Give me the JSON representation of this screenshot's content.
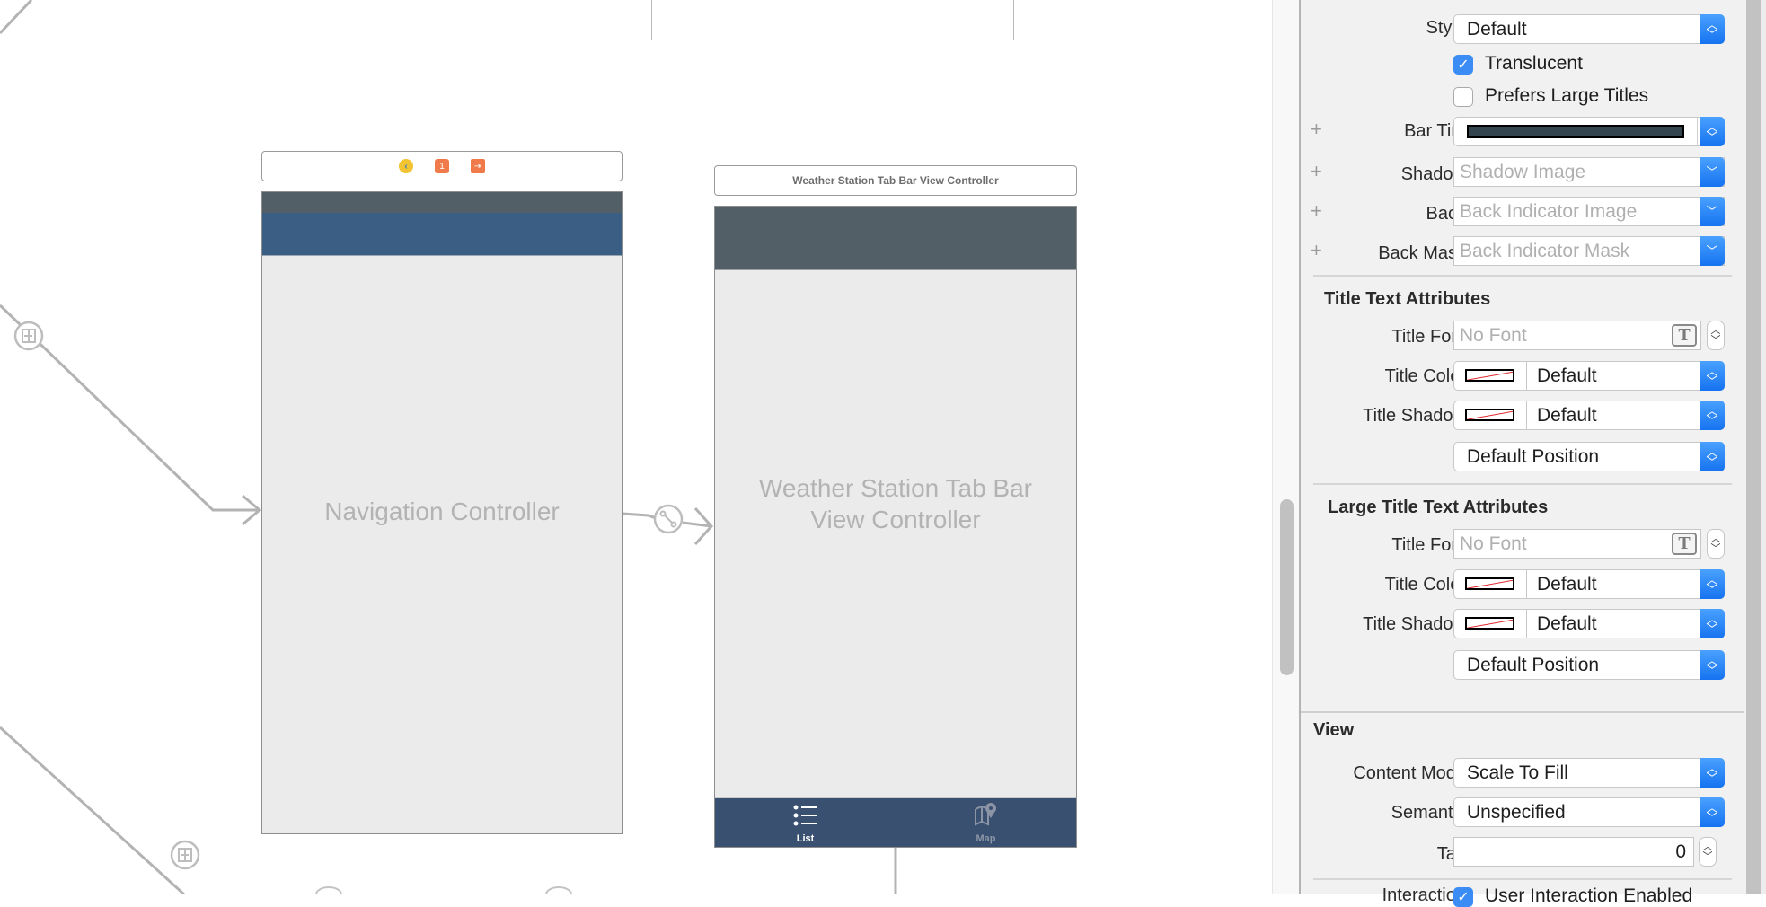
{
  "canvas": {
    "nav_scene": {
      "dock_icons": [
        "back-circle-icon",
        "first-responder-cube-icon",
        "exit-icon"
      ],
      "center_title": "Navigation Controller",
      "colors": {
        "status_bar": "#525f66",
        "nav_bar": "#3a5e84",
        "body": "#ebebeb"
      }
    },
    "tab_scene": {
      "dock_title": "Weather Station Tab Bar View Controller",
      "center_title_line1": "Weather Station Tab Bar",
      "center_title_line2": "View Controller",
      "tabs": [
        {
          "label": "List",
          "icon": "list-icon",
          "selected": true
        },
        {
          "label": "Map",
          "icon": "map-pin-icon",
          "selected": false
        }
      ],
      "colors": {
        "top_bar": "#525f66",
        "tab_bar": "#3a5071",
        "selected_tab": "#ffffff",
        "unselected_tab": "#8c95a5"
      }
    },
    "segue_icons": [
      "embed-segue-icon",
      "relationship-segue-icon",
      "embed-segue-icon"
    ]
  },
  "inspector": {
    "navigation_bar": {
      "style": {
        "label": "Style",
        "value": "Default"
      },
      "translucent": {
        "label": "Translucent",
        "checked": true
      },
      "prefers_large_titles": {
        "label": "Prefers Large Titles",
        "checked": false
      },
      "bar_tint": {
        "label": "Bar Tint",
        "color": "#34454f"
      },
      "shadow": {
        "label": "Shadow",
        "placeholder": "Shadow Image"
      },
      "back": {
        "label": "Back",
        "placeholder": "Back Indicator Image"
      },
      "back_mask": {
        "label": "Back Mask",
        "placeholder": "Back Indicator Mask"
      }
    },
    "title_text_attributes": {
      "heading": "Title Text Attributes",
      "title_font": {
        "label": "Title Font",
        "placeholder": "No Font"
      },
      "title_color": {
        "label": "Title Color",
        "value": "Default"
      },
      "title_shadow": {
        "label": "Title Shadow",
        "value": "Default"
      },
      "position": {
        "value": "Default Position"
      }
    },
    "large_title_text_attributes": {
      "heading": "Large Title Text Attributes",
      "title_font": {
        "label": "Title Font",
        "placeholder": "No Font"
      },
      "title_color": {
        "label": "Title Color",
        "value": "Default"
      },
      "title_shadow": {
        "label": "Title Shadow",
        "value": "Default"
      },
      "position": {
        "value": "Default Position"
      }
    },
    "view": {
      "heading": "View",
      "content_mode": {
        "label": "Content Mode",
        "value": "Scale To Fill"
      },
      "semantic": {
        "label": "Semantic",
        "value": "Unspecified"
      },
      "tag": {
        "label": "Tag",
        "value": "0"
      },
      "interaction": {
        "label": "Interaction",
        "option": "User Interaction Enabled",
        "checked": true
      }
    },
    "accent_color": "#1a7cf5"
  }
}
